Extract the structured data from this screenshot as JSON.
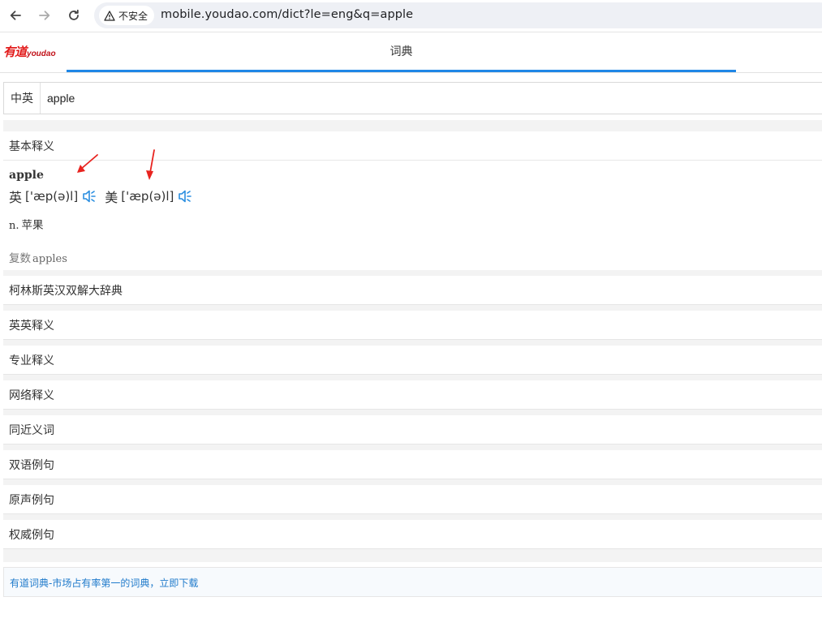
{
  "browser": {
    "security_label": "不安全",
    "url": "mobile.youdao.com/dict?le=eng&q=apple"
  },
  "header": {
    "logo_cn": "有道",
    "logo_en": "youdao",
    "tab_label": "词典",
    "accent_color": "#1f86e6"
  },
  "search": {
    "lang": "中英",
    "value": "apple"
  },
  "basic": {
    "title": "基本释义",
    "word": "apple",
    "uk_label": "英",
    "uk_ipa": "['æp(ə)l]",
    "us_label": "美",
    "us_ipa": "['æp(ə)l]",
    "pos": "n.",
    "meaning": "苹果",
    "plural_label": "复数",
    "plural_word": "apples"
  },
  "sections": [
    "柯林斯英汉双解大辞典",
    "英英释义",
    "专业释义",
    "网络释义",
    "同近义词",
    "双语例句",
    "原声例句",
    "权威例句"
  ],
  "promo": {
    "text": "有道词典-市场占有率第一的词典，立即下载"
  },
  "icons": [
    "back-icon",
    "forward-icon",
    "reload-icon",
    "warning-icon",
    "speaker-icon",
    "annotation-arrow-icon"
  ]
}
